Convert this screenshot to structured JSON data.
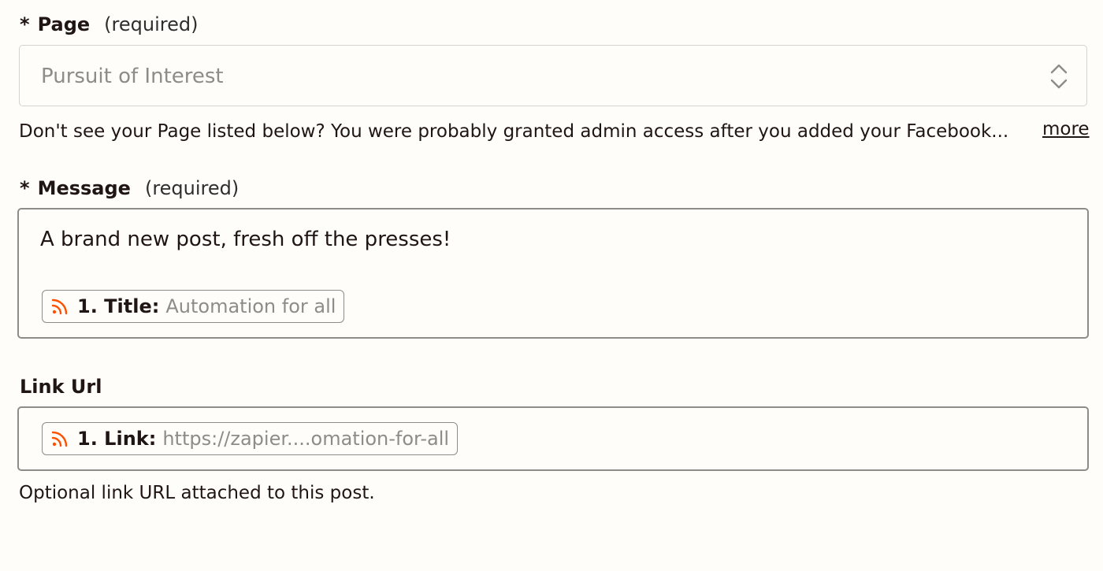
{
  "page_field": {
    "required_marker": "*",
    "label": "Page",
    "hint": "(required)",
    "selected_value": "Pursuit of Interest",
    "help_text": "Don't see your Page listed below? You were probably granted admin access after you added your Facebook...",
    "more_link": "more"
  },
  "message_field": {
    "required_marker": "*",
    "label": "Message",
    "hint": "(required)",
    "text": "A brand new post, fresh off the presses!",
    "pill": {
      "icon": "rss-icon",
      "key": "1. Title:",
      "value": "Automation for all"
    }
  },
  "link_field": {
    "label": "Link Url",
    "pill": {
      "icon": "rss-icon",
      "key": "1. Link:",
      "value": "https://zapier....omation-for-all"
    },
    "help_text": "Optional link URL attached to this post."
  },
  "colors": {
    "background": "#fffdf9",
    "rss_accent": "#ff4f00",
    "border_focus": "#8f8c88",
    "border_light": "#d7d3cc"
  }
}
